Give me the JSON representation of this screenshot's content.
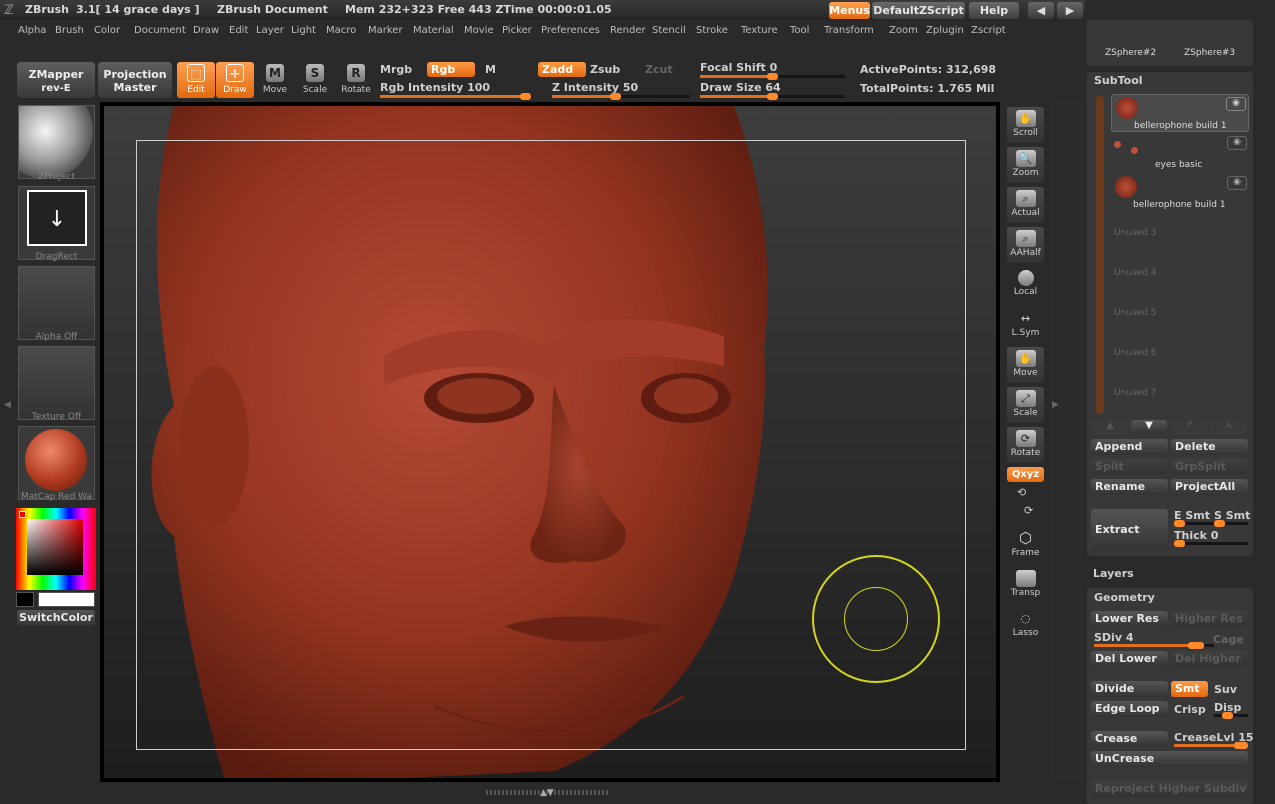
{
  "titlebar": {
    "app": "ZBrush",
    "version": "3.1[ 14 grace days ]",
    "document": "ZBrush Document",
    "mem": "Mem 232+323 Free 443 ZTime 00:00:01.05",
    "menus": "Menus",
    "script": "DefaultZScript",
    "help": "Help"
  },
  "menubar": [
    "Alpha",
    "Brush",
    "Color",
    "Document",
    "Draw",
    "Edit",
    "Layer",
    "Light",
    "Macro",
    "Marker",
    "Material",
    "Movie",
    "Picker",
    "Preferences",
    "Render",
    "Stencil",
    "Stroke",
    "Texture",
    "Tool",
    "Transform",
    "Zoom",
    "Zplugin",
    "Zscript"
  ],
  "toolbar": {
    "zmapper": "ZMapper",
    "zmapper_sub": "rev-E",
    "projection": "Projection",
    "projection_sub": "Master",
    "edit": "Edit",
    "draw": "Draw",
    "move": "Move",
    "scale": "Scale",
    "rotate": "Rotate",
    "mrgb": "Mrgb",
    "rgb": "Rgb",
    "m": "M",
    "rgb_intensity_label": "Rgb Intensity",
    "rgb_intensity": "100",
    "zadd": "Zadd",
    "zsub": "Zsub",
    "zcut": "Zcut",
    "z_intensity_label": "Z Intensity",
    "z_intensity": "50",
    "focal_label": "Focal Shift",
    "focal": "0",
    "drawsize_label": "Draw Size",
    "drawsize": "64",
    "active_label": "ActivePoints:",
    "active": "312,698",
    "total_label": "TotalPoints:",
    "total": "1.765 Mil"
  },
  "left": {
    "zproject": "ZProject",
    "dragrect": "DragRect",
    "alpha": "Alpha Off",
    "texture": "Texture Off",
    "matcap": "MatCap Red Wa",
    "switchcolor": "SwitchColor"
  },
  "righttools": [
    "Scroll",
    "Zoom",
    "Actual",
    "AAHalf",
    "Local",
    "L.Sym",
    "Move",
    "Scale",
    "Rotate",
    "Frame",
    "Transp",
    "Lasso"
  ],
  "xyz": "Qxyz",
  "subtool": {
    "header": "SubTool",
    "zsphere1": "ZSphere#2",
    "zsphere2": "ZSphere#3",
    "items": [
      "bellerophone build 1",
      "eyes basic",
      "bellerophone build 1",
      "Unused 3",
      "Unused 4",
      "Unused 5",
      "Unused 6",
      "Unused 7"
    ],
    "append": "Append",
    "delete": "Delete",
    "split": "Split",
    "grpsplit": "GrpSplit",
    "rename": "Rename",
    "projectall": "ProjectAll",
    "extract": "Extract",
    "e_smt": "E Smt",
    "s_smt": "S Smt",
    "thick_label": "Thick",
    "thick": "0"
  },
  "layers": "Layers",
  "geometry": {
    "header": "Geometry",
    "lower_res": "Lower Res",
    "higher_res": "Higher Res",
    "sdiv_label": "SDiv",
    "sdiv": "4",
    "cage": "Cage",
    "del_lower": "Del Lower",
    "del_higher": "Del Higher",
    "divide": "Divide",
    "smt": "Smt",
    "suv": "Suv",
    "edge_loop": "Edge Loop",
    "crisp": "Crisp",
    "disp": "Disp",
    "crease": "Crease",
    "creaselvl_label": "CreaseLvl",
    "creaselvl": "15",
    "uncrease": "UnCrease",
    "reproject": "Reproject Higher Subdiv"
  },
  "colors": {
    "accent": "#e8731a",
    "skin": "#9e3a28",
    "brush_ring": "#d4d61c"
  }
}
